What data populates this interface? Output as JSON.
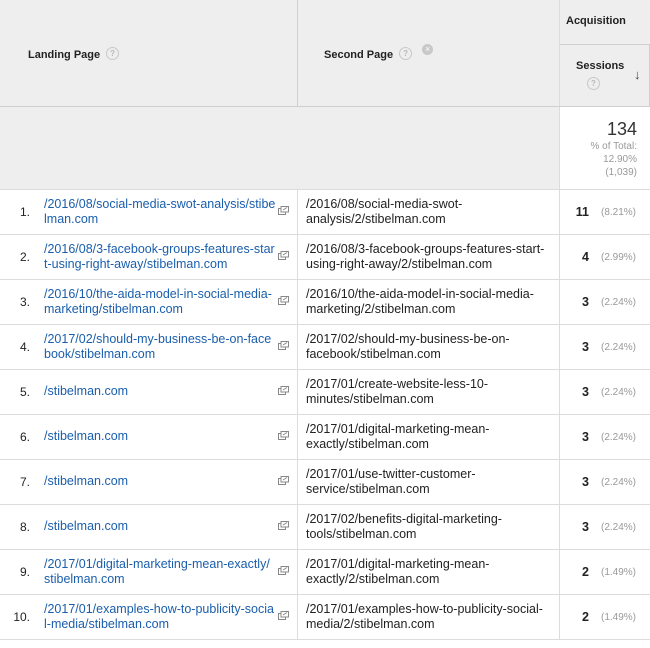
{
  "columns": {
    "landing_page": "Landing Page",
    "second_page": "Second Page",
    "group": "Acquisition",
    "sessions": "Sessions",
    "help_glyph": "?",
    "sort_glyph": "↓",
    "remove_glyph": "×"
  },
  "totals": {
    "sessions": "134",
    "pct_label": "% of Total:",
    "pct_value": "12.90%",
    "overall": "(1,039)"
  },
  "rows": [
    {
      "num": "1.",
      "landing": "/2016/08/social-media-swot-analysis/stibelman.com",
      "second": "/2016/08/social-media-swot-analysis/2/stibelman.com",
      "sessions": "11",
      "pct": "(8.21%)"
    },
    {
      "num": "2.",
      "landing": "/2016/08/3-facebook-groups-features-start-using-right-away/stibelman.com",
      "second": "/2016/08/3-facebook-groups-features-start-using-right-away/2/stibelman.com",
      "sessions": "4",
      "pct": "(2.99%)"
    },
    {
      "num": "3.",
      "landing": "/2016/10/the-aida-model-in-social-media-marketing/stibelman.com",
      "second": "/2016/10/the-aida-model-in-social-media-marketing/2/stibelman.com",
      "sessions": "3",
      "pct": "(2.24%)"
    },
    {
      "num": "4.",
      "landing": "/2017/02/should-my-business-be-on-facebook/stibelman.com",
      "second": "/2017/02/should-my-business-be-on-facebook/stibelman.com",
      "sessions": "3",
      "pct": "(2.24%)"
    },
    {
      "num": "5.",
      "landing": "/stibelman.com",
      "second": "/2017/01/create-website-less-10-minutes/stibelman.com",
      "sessions": "3",
      "pct": "(2.24%)"
    },
    {
      "num": "6.",
      "landing": "/stibelman.com",
      "second": "/2017/01/digital-marketing-mean-exactly/stibelman.com",
      "sessions": "3",
      "pct": "(2.24%)"
    },
    {
      "num": "7.",
      "landing": "/stibelman.com",
      "second": "/2017/01/use-twitter-customer-service/stibelman.com",
      "sessions": "3",
      "pct": "(2.24%)"
    },
    {
      "num": "8.",
      "landing": "/stibelman.com",
      "second": "/2017/02/benefits-digital-marketing-tools/stibelman.com",
      "sessions": "3",
      "pct": "(2.24%)"
    },
    {
      "num": "9.",
      "landing": "/2017/01/digital-marketing-mean-exactly/stibelman.com",
      "second": "/2017/01/digital-marketing-mean-exactly/2/stibelman.com",
      "sessions": "2",
      "pct": "(1.49%)"
    },
    {
      "num": "10.",
      "landing": "/2017/01/examples-how-to-publicity-social-media/stibelman.com",
      "second": "/2017/01/examples-how-to-publicity-social-media/2/stibelman.com",
      "sessions": "2",
      "pct": "(1.49%)"
    }
  ],
  "icons": {
    "help": "help-icon",
    "remove": "remove-dimension-icon",
    "sort": "sort-descending-icon",
    "external": "open-external-link-icon"
  }
}
